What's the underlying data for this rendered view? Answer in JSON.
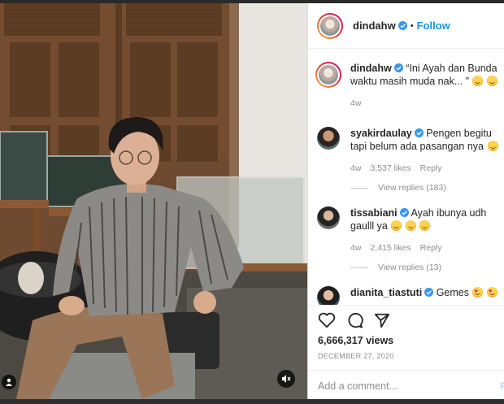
{
  "header": {
    "username": "dindahw",
    "follow_label": "Follow",
    "separator": "•"
  },
  "caption": {
    "username": "dindahw",
    "text": "“Ini Ayah dan Bunda waktu masih muda nak... ”",
    "emojis": [
      "laughing-tear-emoji",
      "laughing-emoji"
    ],
    "time": "4w"
  },
  "comments": [
    {
      "username": "syakirdaulay",
      "text": "Pengen begitu tapi belum ada pasangan nya",
      "emojis": [
        "upside-down-emoji"
      ],
      "time": "4w",
      "likes": "3,537 likes",
      "reply_label": "Reply",
      "view_replies": "View replies (183)"
    },
    {
      "username": "tissabiani",
      "text": "Ayah ibunya udh gaulll ya",
      "emojis": [
        "tongue-wink-emoji",
        "tongue-wink-emoji",
        "tongue-wink-emoji"
      ],
      "time": "4w",
      "likes": "2,415 likes",
      "reply_label": "Reply",
      "view_replies": "View replies (13)"
    },
    {
      "username": "dianita_tiastuti",
      "text": "Gemes",
      "emojis": [
        "star-struck-emoji",
        "star-struck-emoji"
      ]
    }
  ],
  "stats": {
    "views": "6,666,317 views",
    "date": "DECEMBER 27, 2020"
  },
  "composer": {
    "placeholder": "Add a comment...",
    "post_label": "P"
  },
  "colors": {
    "accent_blue": "#1a94e0",
    "verified_blue": "#3897f0",
    "muted_text": "#8e8e8e"
  }
}
